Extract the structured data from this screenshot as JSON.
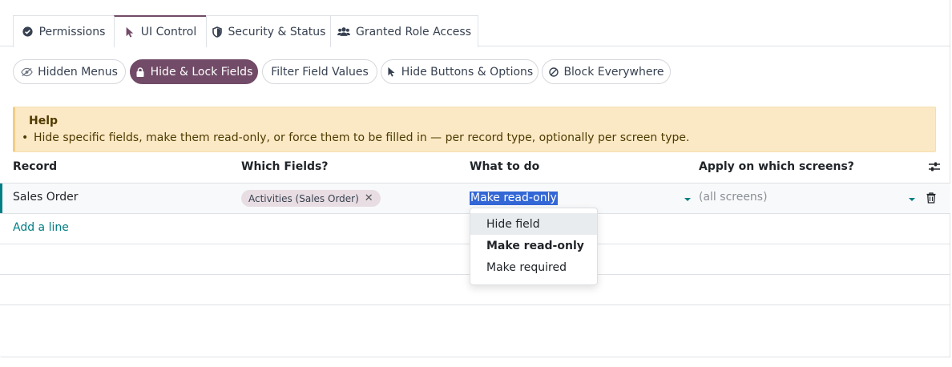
{
  "tabs": [
    {
      "label": "Permissions",
      "icon": "check-circle-icon"
    },
    {
      "label": "UI Control",
      "icon": "pointer-icon"
    },
    {
      "label": "Security & Status",
      "icon": "shield-icon"
    },
    {
      "label": "Granted Role Access",
      "icon": "users-icon"
    }
  ],
  "active_tab": "UI Control",
  "subtabs": [
    {
      "label": "Hidden Menus",
      "icon": "eye-slash-icon"
    },
    {
      "label": "Hide & Lock Fields",
      "icon": "lock-icon"
    },
    {
      "label": "Filter Field Values",
      "icon": ""
    },
    {
      "label": "Hide Buttons & Options",
      "icon": "pointer-icon"
    },
    {
      "label": "Block Everywhere",
      "icon": "ban-icon"
    }
  ],
  "active_subtab": "Hide & Lock Fields",
  "help": {
    "title": "Help",
    "items": [
      "Hide specific fields, make them read-only, or force them to be filled in — per record type, optionally per screen type."
    ]
  },
  "table": {
    "columns": [
      "Record",
      "Which Fields?",
      "What to do",
      "Apply on which screens?"
    ],
    "rows": [
      {
        "record": "Sales Order",
        "fields": [
          "Activities (Sales Order)"
        ],
        "action": "Make read-only",
        "screens_placeholder": "(all screens)"
      }
    ],
    "add_line": "Add a line"
  },
  "dropdown": {
    "options": [
      "Hide field",
      "Make read-only",
      "Make required"
    ],
    "hovered": "Hide field",
    "selected": "Make read-only"
  },
  "colors": {
    "accent": "#714b67",
    "link": "#017e84",
    "help_bg": "#fbe9c5",
    "selection": "#3367d6"
  }
}
